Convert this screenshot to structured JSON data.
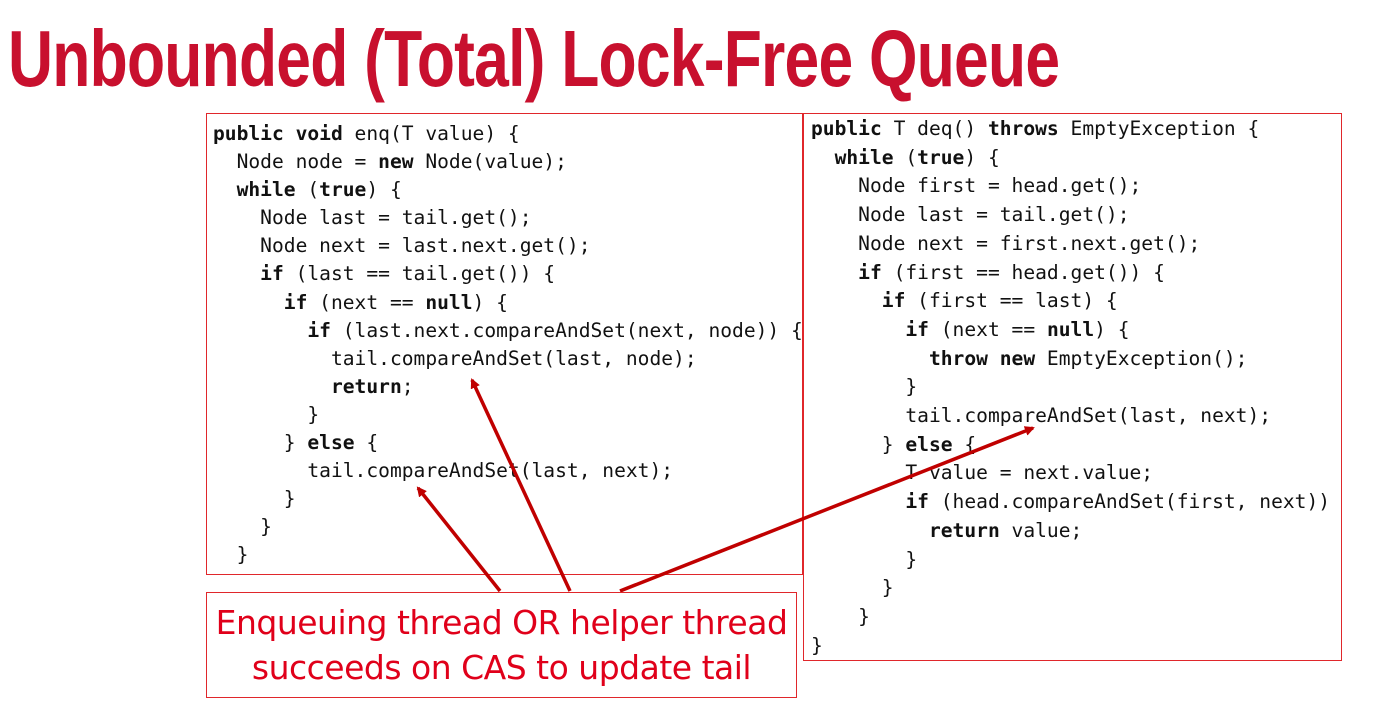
{
  "slide": {
    "title": "Unbounded (Total) Lock-Free Queue",
    "accent_color": "#c8102e",
    "enq_code": [
      [
        {
          "t": "public void",
          "b": true
        },
        {
          "t": " enq(T value) {",
          "b": false
        }
      ],
      [
        {
          "t": "  Node node = ",
          "b": false
        },
        {
          "t": "new",
          "b": true
        },
        {
          "t": " Node(value);",
          "b": false
        }
      ],
      [
        {
          "t": "  while",
          "b": true
        },
        {
          "t": " (",
          "b": false
        },
        {
          "t": "true",
          "b": true
        },
        {
          "t": ") {",
          "b": false
        }
      ],
      [
        {
          "t": "    Node last = tail.get();",
          "b": false
        }
      ],
      [
        {
          "t": "    Node next = last.next.get();",
          "b": false
        }
      ],
      [
        {
          "t": "    if",
          "b": true
        },
        {
          "t": " (last == tail.get()) {",
          "b": false
        }
      ],
      [
        {
          "t": "      if",
          "b": true
        },
        {
          "t": " (next == ",
          "b": false
        },
        {
          "t": "null",
          "b": true
        },
        {
          "t": ") {",
          "b": false
        }
      ],
      [
        {
          "t": "        if",
          "b": true
        },
        {
          "t": " (last.next.compareAndSet(next, node)) {",
          "b": false
        }
      ],
      [
        {
          "t": "          tail.compareAndSet(last, node);",
          "b": false
        }
      ],
      [
        {
          "t": "          return",
          "b": true
        },
        {
          "t": ";",
          "b": false
        }
      ],
      [
        {
          "t": "        }",
          "b": false
        }
      ],
      [
        {
          "t": "      } ",
          "b": false
        },
        {
          "t": "else",
          "b": true
        },
        {
          "t": " {",
          "b": false
        }
      ],
      [
        {
          "t": "        tail.compareAndSet(last, next);",
          "b": false
        }
      ],
      [
        {
          "t": "      }",
          "b": false
        }
      ],
      [
        {
          "t": "    }",
          "b": false
        }
      ],
      [
        {
          "t": "  }",
          "b": false
        }
      ]
    ],
    "deq_code": [
      [
        {
          "t": "public",
          "b": true
        },
        {
          "t": " T deq() ",
          "b": false
        },
        {
          "t": "throws",
          "b": true
        },
        {
          "t": " EmptyException {",
          "b": false
        }
      ],
      [
        {
          "t": "  while",
          "b": true
        },
        {
          "t": " (",
          "b": false
        },
        {
          "t": "true",
          "b": true
        },
        {
          "t": ") {",
          "b": false
        }
      ],
      [
        {
          "t": "    Node first = head.get();",
          "b": false
        }
      ],
      [
        {
          "t": "    Node last = tail.get();",
          "b": false
        }
      ],
      [
        {
          "t": "    Node next = first.next.get();",
          "b": false
        }
      ],
      [
        {
          "t": "    if",
          "b": true
        },
        {
          "t": " (first == head.get()) {",
          "b": false
        }
      ],
      [
        {
          "t": "      if",
          "b": true
        },
        {
          "t": " (first == last) {",
          "b": false
        }
      ],
      [
        {
          "t": "        if",
          "b": true
        },
        {
          "t": " (next == ",
          "b": false
        },
        {
          "t": "null",
          "b": true
        },
        {
          "t": ") {",
          "b": false
        }
      ],
      [
        {
          "t": "          throw new",
          "b": true
        },
        {
          "t": " EmptyException();",
          "b": false
        }
      ],
      [
        {
          "t": "        }",
          "b": false
        }
      ],
      [
        {
          "t": "        tail.compareAndSet(last, next);",
          "b": false
        }
      ],
      [
        {
          "t": "      } ",
          "b": false
        },
        {
          "t": "else",
          "b": true
        },
        {
          "t": " {",
          "b": false
        }
      ],
      [
        {
          "t": "        T value = next.value;",
          "b": false
        }
      ],
      [
        {
          "t": "        if",
          "b": true
        },
        {
          "t": " (head.compareAndSet(first, next))",
          "b": false
        }
      ],
      [
        {
          "t": "          return",
          "b": true
        },
        {
          "t": " value;",
          "b": false
        }
      ],
      [
        {
          "t": "        }",
          "b": false
        }
      ],
      [
        {
          "t": "      }",
          "b": false
        }
      ],
      [
        {
          "t": "    }",
          "b": false
        }
      ],
      [
        {
          "t": "}",
          "b": false
        }
      ]
    ],
    "caption_line1": "Enqueuing thread OR helper thread",
    "caption_line2": "succeeds on CAS to update tail",
    "arrow_color": "#c00000"
  }
}
